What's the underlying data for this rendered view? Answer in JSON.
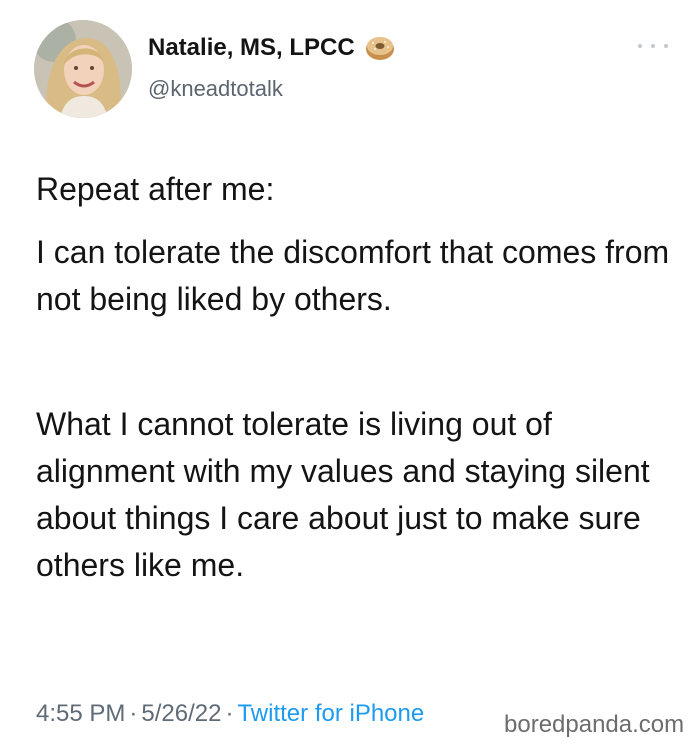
{
  "author": {
    "display_name": "Natalie, MS, LPCC",
    "handle": "@kneadtotalk",
    "avatar_icon": "profile-photo",
    "badge_icon": "bagel-emoji-icon"
  },
  "tweet": {
    "paragraphs": [
      "Repeat after me:",
      "I can tolerate the discomfort that comes from not being liked by others.",
      "What I cannot tolerate is living out of alignment with my values and staying silent about things I care about just to make sure others like me."
    ]
  },
  "meta": {
    "time": "4:55 PM",
    "separator": "·",
    "date": "5/26/22",
    "source": "Twitter for iPhone"
  },
  "watermark": "boredpanda.com",
  "colors": {
    "text": "#141414",
    "meta": "#5f6b76",
    "link": "#1d9bf0"
  }
}
